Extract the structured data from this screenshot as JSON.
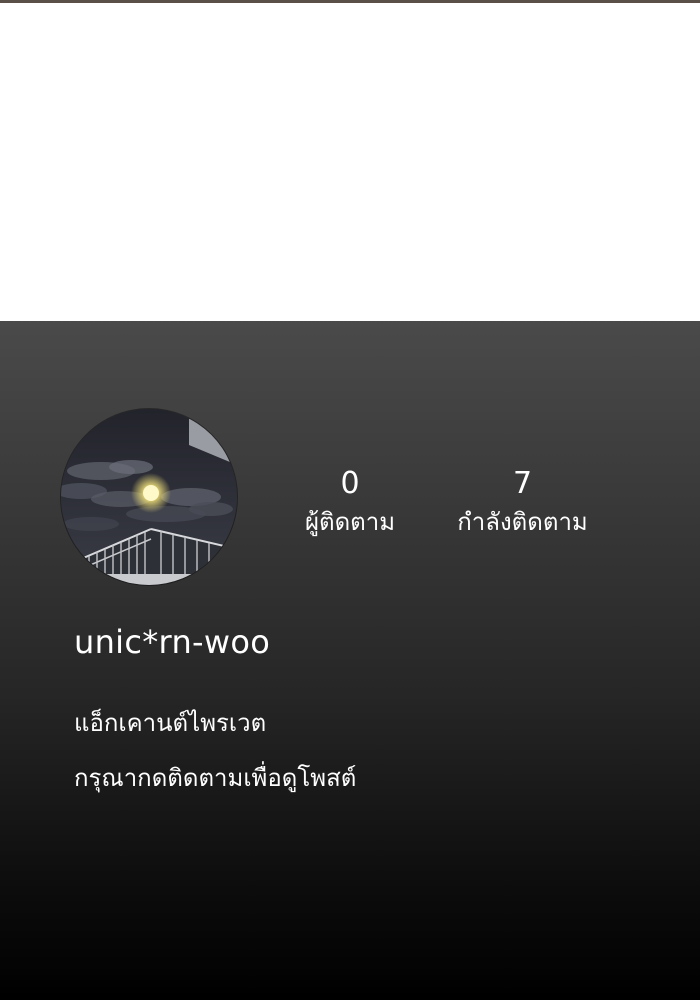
{
  "profile": {
    "username": "unic*rn-woo",
    "avatar_icon": "moon-night-balcony-image",
    "stats": {
      "followers": {
        "value": "0",
        "label": "ผู้ติดตาม"
      },
      "following": {
        "value": "7",
        "label": "กำลังติดตาม"
      }
    },
    "private_notice": {
      "line1": "แอ็กเคานต์ไพรเวต",
      "line2": "กรุณากดติดตามเพื่อดูโพสต์"
    }
  },
  "colors": {
    "panel_top": "#4a4a4a",
    "panel_bottom": "#000000",
    "text": "#ffffff",
    "top_strip": "#5a5048"
  }
}
